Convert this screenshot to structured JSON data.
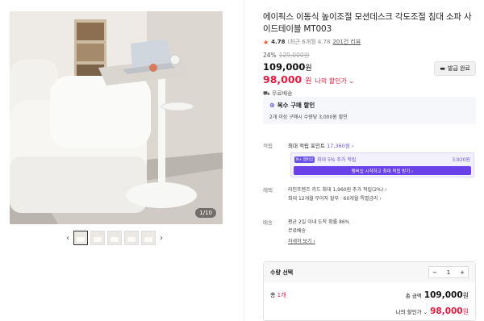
{
  "gallery": {
    "counter": "1/10",
    "prev_icon": "chevron-left-icon",
    "next_icon": "chevron-right-icon",
    "thumb_count": 5
  },
  "product": {
    "title": "에이픽스 이동식 높이조절 모션데스크 각도조절 침대 소파 사이드테이블 MT003",
    "rating": "4.78",
    "rating_detail": "(최근 6개월 4.78",
    "review_link": "201건 리뷰",
    "discount_pct": "24%",
    "original_price": "129,000원",
    "price_value": "109,000",
    "price_unit": "원",
    "my_price_value": "98,000",
    "my_price_unit": "원",
    "my_price_label": "나의 할인가 ⌄",
    "shipping_text": "무료배송",
    "coupon_button": "발급 완료"
  },
  "benefit": {
    "title": "복수 구매 할인",
    "desc": "2개 이상 구매시 수량당 3,000원 할인"
  },
  "points": {
    "label": "적립",
    "max_text": "최대 적립 포인트",
    "max_value": "17,360원 ›",
    "member_badge": "N+ 멤버십",
    "member_extra": "최대 5% 추가 적립",
    "member_amount": "3,920원",
    "member_button": "멤버십 시작하고 최대 적립 받기 ›"
  },
  "card_benefit": {
    "label": "혜택",
    "line1": "라인프렌즈 카드 최대 1,960원 추가 적립(2%) ›",
    "line2": "최대 12개월 무이자 할부 · 60개월 특별금리 ›"
  },
  "delivery": {
    "label": "배송",
    "line1": "평균 2일 이내 도착 확률 86%",
    "line2": "무료배송",
    "detail_link": "자세히 보기 ›"
  },
  "quantity": {
    "header": "수량 선택",
    "minus": "−",
    "value": "1",
    "plus": "+",
    "total_count_prefix": "총 ",
    "total_count": "1개",
    "total_label": "총 금액",
    "total_value": "109,000",
    "total_unit": "원",
    "my_label": "나의 할인가 ⌄",
    "my_value": "98,000",
    "my_unit": "원"
  },
  "colors": {
    "accent_red": "#e8183e",
    "membership_purple": "#6a40e8",
    "star": "#f2502c"
  }
}
